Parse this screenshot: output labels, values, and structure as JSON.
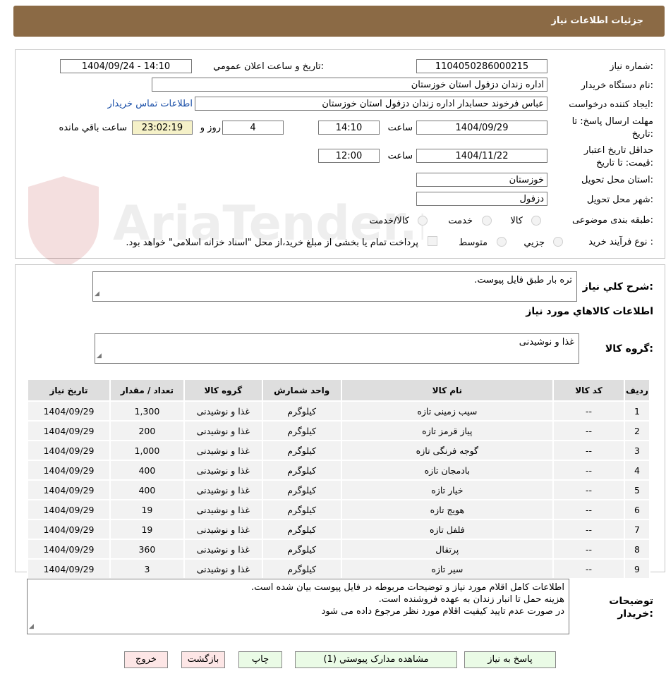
{
  "header": {
    "title": "جزئيات اطلاعات نياز"
  },
  "watermark": {
    "text": "AriaTender.neT"
  },
  "info": {
    "need_number_label": "شماره نياز:",
    "need_number": "1104050286000215",
    "announce_label": "تاريخ و ساعت اعلان عمومي:",
    "announce_value": "1404/09/24 - 14:10",
    "buyer_org_label": "نام دستگاه خريدار:",
    "buyer_org": "اداره زندان دزفول استان خوزستان",
    "requester_label": "ايجاد کننده درخواست:",
    "requester": "عباس فرخوند حسابدار اداره زندان دزفول استان خوزستان",
    "contact_link": "اطلاعات تماس خريدار",
    "reply_deadline_label_1": "مهلت ارسال پاسخ: تا",
    "reply_deadline_label_2": "تاريخ:",
    "reply_date": "1404/09/29",
    "time_label": "ساعت",
    "reply_time": "14:10",
    "days": "4",
    "days_label": "روز و",
    "remaining": "23:02:19",
    "remaining_label": "ساعت باقي مانده",
    "validity_label_1": "حداقل تاريخ اعتبار",
    "validity_label_2": "قيمت: تا تاريخ:",
    "validity_date": "1404/11/22",
    "validity_time": "12:00",
    "province_label": "استان محل تحويل:",
    "province": "خوزستان",
    "city_label": "شهر محل تحويل:",
    "city": "دزفول",
    "category_label": "طبقه بندی موضوعی:",
    "category_options": [
      "کالا",
      "خدمت",
      "کالا/خدمت"
    ],
    "process_label": "نوع فرآيند خريد :",
    "process_options": [
      "جزيي",
      "متوسط"
    ],
    "payment_note": "پرداخت تمام يا بخشی از مبلغ خريد،از محل \"اسناد خزانه اسلامی\" خواهد بود."
  },
  "summary": {
    "desc_label": "شرح کلي نياز:",
    "desc_value": "تره بار طبق فایل پیوست.",
    "goods_info_title": "اطلاعات کالاهاي مورد نياز",
    "group_label": "گروه کالا:",
    "group_value": "غذا و نوشیدنی"
  },
  "table": {
    "headers": [
      "رديف",
      "کد کالا",
      "نام کالا",
      "واحد شمارش",
      "گروه کالا",
      "تعداد / مقدار",
      "تاريخ نياز"
    ],
    "rows": [
      [
        "1",
        "--",
        "سیب زمینی تازه",
        "کیلوگرم",
        "غذا و نوشیدنی",
        "1,300",
        "1404/09/29"
      ],
      [
        "2",
        "--",
        "پیاز قرمز تازه",
        "کیلوگرم",
        "غذا و نوشیدنی",
        "200",
        "1404/09/29"
      ],
      [
        "3",
        "--",
        "گوجه فرنگی تازه",
        "کیلوگرم",
        "غذا و نوشیدنی",
        "1,000",
        "1404/09/29"
      ],
      [
        "4",
        "--",
        "بادمجان تازه",
        "کیلوگرم",
        "غذا و نوشیدنی",
        "400",
        "1404/09/29"
      ],
      [
        "5",
        "--",
        "خیار تازه",
        "کیلوگرم",
        "غذا و نوشیدنی",
        "400",
        "1404/09/29"
      ],
      [
        "6",
        "--",
        "هویج تازه",
        "کیلوگرم",
        "غذا و نوشیدنی",
        "19",
        "1404/09/29"
      ],
      [
        "7",
        "--",
        "فلفل تازه",
        "کیلوگرم",
        "غذا و نوشیدنی",
        "19",
        "1404/09/29"
      ],
      [
        "8",
        "--",
        "پرتقال",
        "کیلوگرم",
        "غذا و نوشیدنی",
        "360",
        "1404/09/29"
      ],
      [
        "9",
        "--",
        "سیر تازه",
        "کیلوگرم",
        "غذا و نوشیدنی",
        "3",
        "1404/09/29"
      ]
    ]
  },
  "notes": {
    "label_1": "توضيحات",
    "label_2": "خريدار:",
    "lines": [
      "اطلاعات کامل اقلام مورد نیاز و توضیحات مربوطه در فایل پیوست بیان شده است.",
      "هزینه حمل تا انبار زندان به عهده فروشنده است.",
      "در صورت عدم تایید کیفیت اقلام مورد نظر مرجوع داده می شود"
    ]
  },
  "buttons": {
    "reply": "پاسخ به نياز",
    "attachments": "مشاهده مدارک پيوستي (1)",
    "print": "چاپ",
    "back": "بازگشت",
    "exit": "خروج"
  }
}
